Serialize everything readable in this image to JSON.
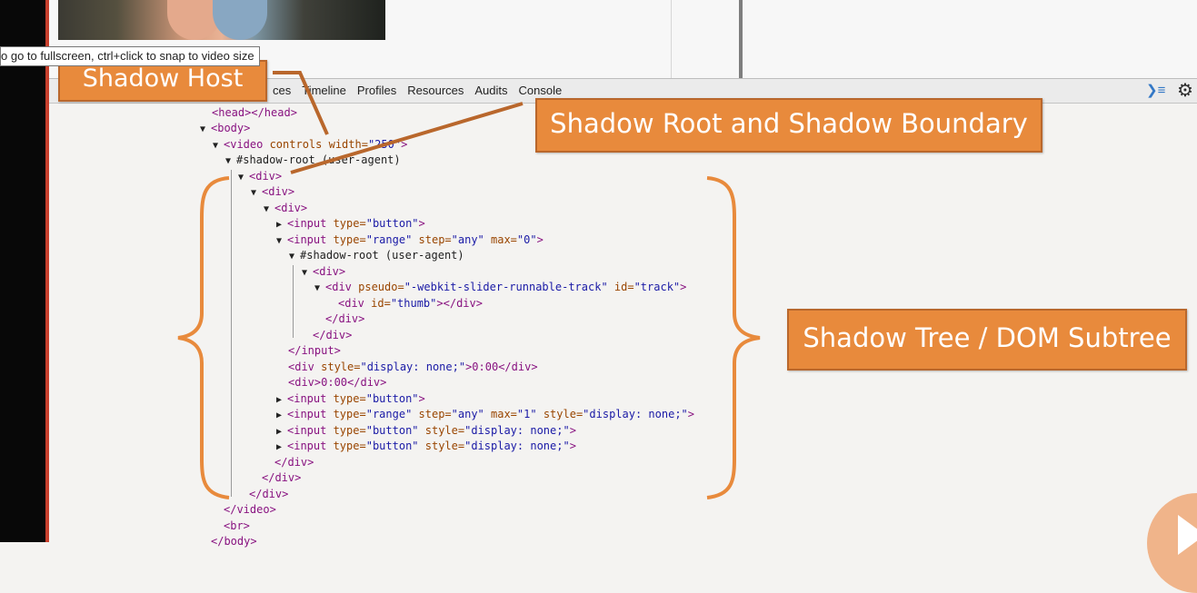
{
  "tooltip": {
    "text": "o go to fullscreen, ctrl+click to snap to video size"
  },
  "toolbar": {
    "tabs": [
      "ces",
      "Timeline",
      "Profiles",
      "Resources",
      "Audits",
      "Console"
    ],
    "icons": [
      "console-drawer-icon",
      "gear-icon"
    ]
  },
  "callouts": {
    "shadow_host": "Shadow Host",
    "shadow_root": "Shadow Root and Shadow Boundary",
    "shadow_tree": "Shadow Tree / DOM Subtree"
  },
  "code": {
    "l01": "<head></head>",
    "l02": "<body>",
    "l03_tag": "<video",
    "l03_attr": " controls width=",
    "l03_val": "\"250\"",
    "l03_end": ">",
    "l04": "#shadow-root (user-agent)",
    "l05": "<div>",
    "l06": "<div>",
    "l07": "<div>",
    "l08_tag": "<input",
    "l08_attr": " type=",
    "l08_val": "\"button\"",
    "l08_end": ">",
    "l09_tag": "<input",
    "l09_a1": " type=",
    "l09_v1": "\"range\"",
    "l09_a2": " step=",
    "l09_v2": "\"any\"",
    "l09_a3": " max=",
    "l09_v3": "\"0\"",
    "l09_end": ">",
    "l10": "#shadow-root (user-agent)",
    "l11": "<div>",
    "l12_tag": "<div",
    "l12_a1": " pseudo=",
    "l12_v1": "\"-webkit-slider-runnable-track\"",
    "l12_a2": " id=",
    "l12_v2": "\"track\"",
    "l12_end": ">",
    "l13_tag": "<div",
    "l13_a1": " id=",
    "l13_v1": "\"thumb\"",
    "l13_end": "></div>",
    "l14": "</div>",
    "l15": "</div>",
    "l16": "</input>",
    "l17_tag": "<div",
    "l17_a1": " style=",
    "l17_v1": "\"display: none;\"",
    "l17_end": ">0:00</div>",
    "l18": "<div>0:00</div>",
    "l19_tag": "<input",
    "l19_a1": " type=",
    "l19_v1": "\"button\"",
    "l19_end": ">",
    "l20_tag": "<input",
    "l20_a1": " type=",
    "l20_v1": "\"range\"",
    "l20_a2": " step=",
    "l20_v2": "\"any\"",
    "l20_a3": " max=",
    "l20_v3": "\"1\"",
    "l20_a4": " style=",
    "l20_v4": "\"display: none;\"",
    "l20_end": ">",
    "l21_tag": "<input",
    "l21_a1": " type=",
    "l21_v1": "\"button\"",
    "l21_a2": " style=",
    "l21_v2": "\"display: none;\"",
    "l21_end": ">",
    "l22_tag": "<input",
    "l22_a1": " type=",
    "l22_v1": "\"button\"",
    "l22_a2": " style=",
    "l22_v2": "\"display: none;\"",
    "l22_end": ">",
    "l23": "</div>",
    "l24": "</div>",
    "l25": "</div>",
    "l26": "</video>",
    "l27": "<br>",
    "l28": "</body>"
  },
  "colors": {
    "callout_fill": "#e88a3c",
    "callout_border": "#b9672c",
    "tag": "#881280",
    "attr_name": "#994500",
    "attr_value": "#1a1aa6"
  }
}
